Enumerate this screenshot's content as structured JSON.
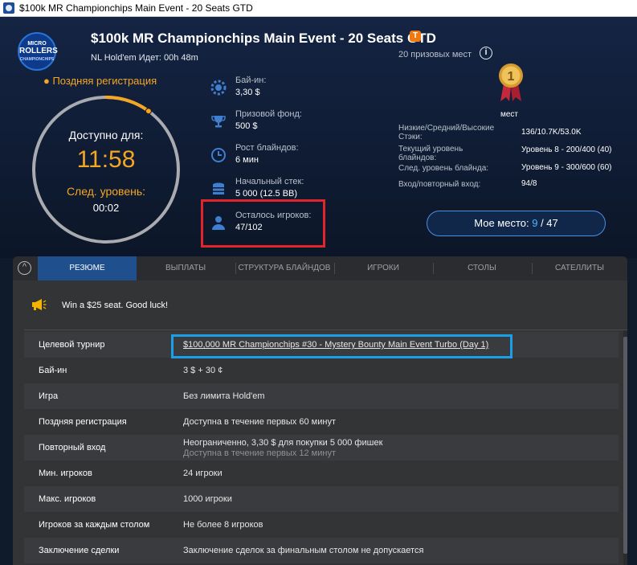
{
  "window": {
    "title": "$100k MR Championchips Main Event - 20 Seats GTD"
  },
  "header": {
    "logo_lines": [
      "MICRO",
      "ROLLERS",
      "CHAMPIONCHIPS"
    ],
    "title": "$100k MR Championchips Main Event - 20 Seats GTD",
    "badge": "T",
    "game_line": "NL Hold'em   Идет: 00h 48m",
    "prize_places": "20 призовых мест"
  },
  "timer": {
    "late_reg": "● Поздняя регистрация",
    "available_label": "Доступно для:",
    "available_time": "11:58",
    "next_level_label": "След. уровень:",
    "next_level_time": "00:02",
    "progress_fraction": 0.1
  },
  "stats": [
    {
      "label": "Бай-ин:",
      "value": "3,30 $",
      "icon": "poker-chip-icon"
    },
    {
      "label": "Призовой фонд:",
      "value": "500 $",
      "icon": "trophy-icon"
    },
    {
      "label": "Рост блайндов:",
      "value": "6 мин",
      "icon": "clock-icon"
    },
    {
      "label": "Начальный стек:",
      "value": "5 000 (12.5 BB)",
      "icon": "chip-stack-icon"
    },
    {
      "label": "Осталось игроков:",
      "value": "47/102",
      "icon": "user-icon"
    }
  ],
  "right": {
    "medal_digit": "1",
    "place_label": "мест",
    "stats": [
      {
        "label": "Низкие/Средний/Высокие Стэки:",
        "value": "136/10.7K/53.0K"
      },
      {
        "label": "Текущий уровень блайндов:",
        "value": "Уровень 8 - 200/400 (40)"
      },
      {
        "label": "След. уровень блайнда:",
        "value": "Уровень 9 - 300/600 (60)"
      },
      {
        "label": "Вход/повторный вход:",
        "value": "94/8"
      }
    ],
    "my_place_label": "Мое место:",
    "my_place_current": "9",
    "my_place_total": " / 47"
  },
  "tabs": [
    "РЕЗЮМЕ",
    "ВЫПЛАТЫ",
    "СТРУКТУРА БЛАЙНДОВ",
    "ИГРОКИ",
    "СТОЛЫ",
    "САТЕЛЛИТЫ"
  ],
  "summary": {
    "announcement": "Win a $25 seat. Good luck!",
    "rows": [
      {
        "label": "Целевой турнир",
        "value": "$100,000 MR Championchips #30 - Mystery Bounty Main Event Turbo (Day 1)"
      },
      {
        "label": "Бай-ин",
        "value": "3 $ + 30 ¢"
      },
      {
        "label": "Игра",
        "value": "Без лимита Hold'em"
      },
      {
        "label": "Поздняя регистрация",
        "value": "Доступна в течение первых 60 минут"
      },
      {
        "label": "Повторный вход",
        "value": "Неограниченно, 3,30 $ для покупки 5 000 фишек",
        "sub": "Доступна в течение первых 12 минут"
      },
      {
        "label": "Мин. игроков",
        "value": "24 игроки"
      },
      {
        "label": "Макс. игроков",
        "value": "1000 игроки"
      },
      {
        "label": "Игроков за каждым столом",
        "value": "Не более 8 игроков"
      },
      {
        "label": "Заключение сделки",
        "value": "Заключение сделок за финальным столом не допускается"
      }
    ]
  },
  "colors": {
    "accent_orange": "#f5a623",
    "accent_blue": "#4fb3ff",
    "highlight_red": "#e2242b",
    "highlight_blue": "#1aa0e6"
  }
}
